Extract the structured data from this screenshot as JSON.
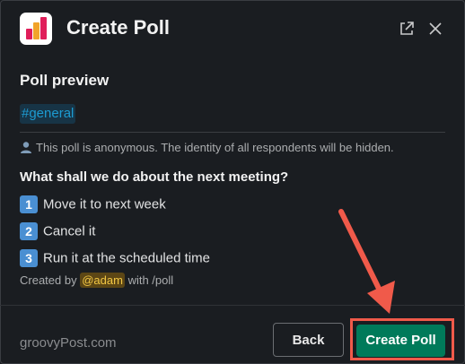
{
  "header": {
    "title": "Create Poll"
  },
  "preview": {
    "heading": "Poll preview",
    "channel": "#general",
    "anonymous_notice": "This poll is anonymous. The identity of all respondents will be hidden.",
    "question": "What shall we do about the next meeting?",
    "options": [
      {
        "number": "1",
        "label": "Move it to next week"
      },
      {
        "number": "2",
        "label": "Cancel it"
      },
      {
        "number": "3",
        "label": "Run it at the scheduled time"
      }
    ],
    "created_by_prefix": "Created by",
    "created_by_user": "@adam",
    "created_by_suffix": "with /poll"
  },
  "footer": {
    "back_label": "Back",
    "create_label": "Create Poll"
  },
  "watermark": "groovyPost.com",
  "colors": {
    "background": "#1a1d21",
    "accent_green": "#007a5a",
    "channel_blue": "#1d9bd1",
    "mention_gold": "#f2c744",
    "annotation_red": "#f05a4a",
    "number_badge_blue": "#4a8fd2"
  }
}
